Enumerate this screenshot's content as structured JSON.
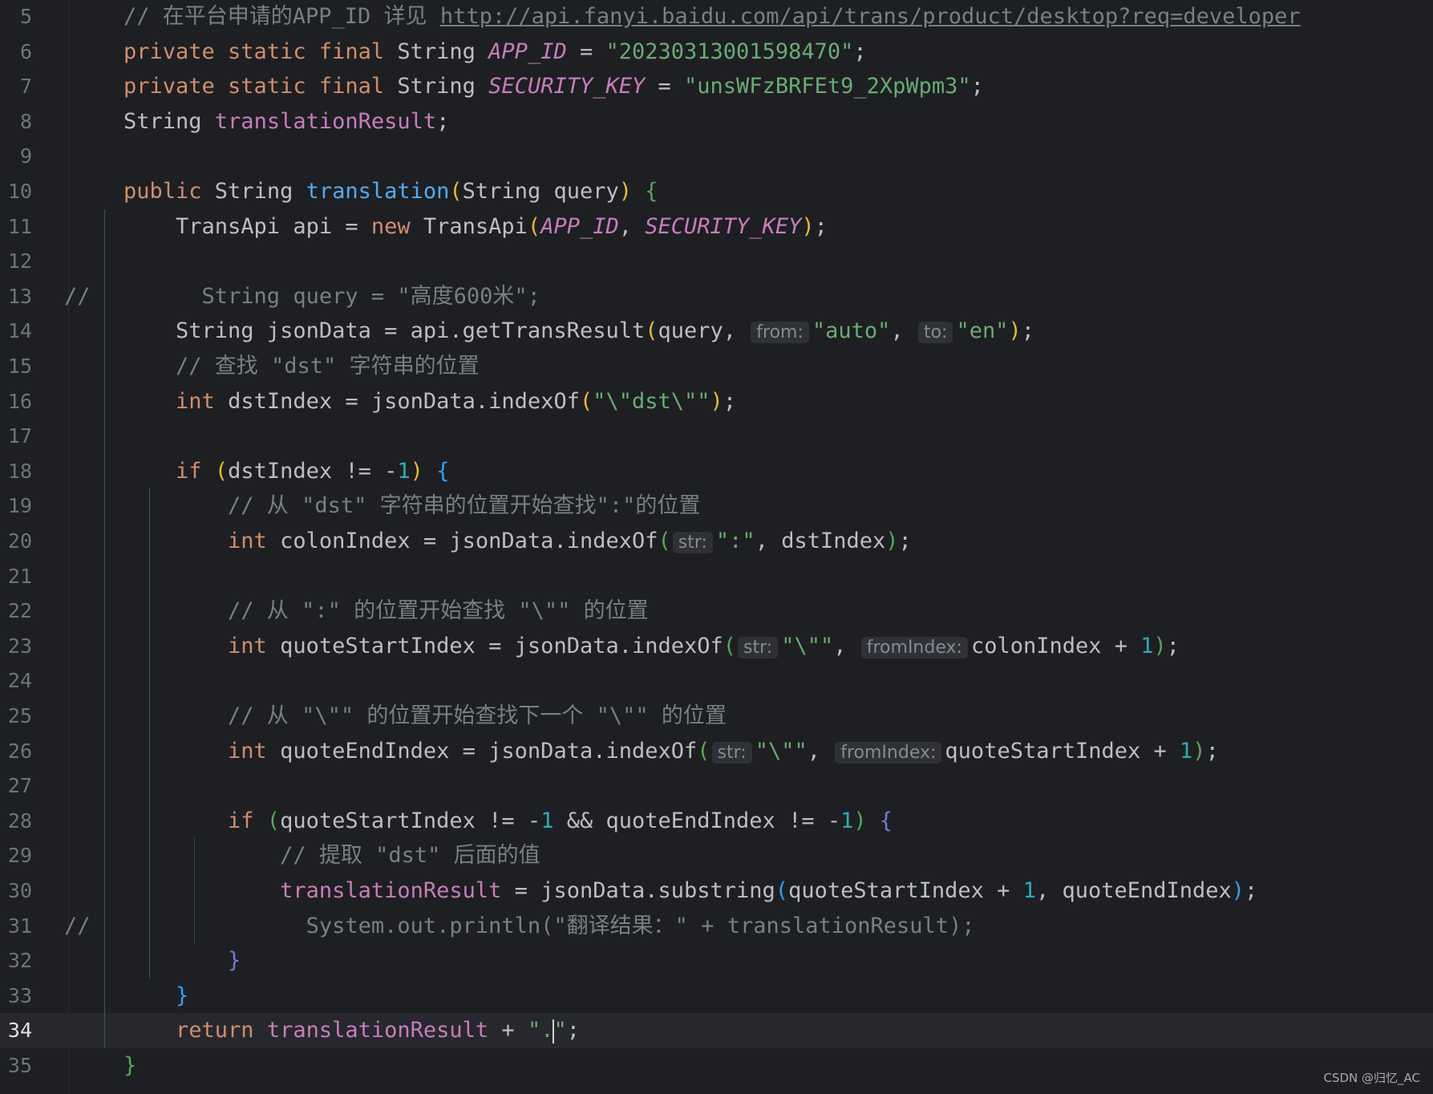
{
  "editor": {
    "current_line": 34,
    "watermark": "CSDN @归忆_AC",
    "lines": [
      {
        "n": "5",
        "tokens": [
          {
            "t": "// 在平台申请的APP_ID 详见 ",
            "c": "cmt"
          },
          {
            "t": "http://api.fanyi.baidu.com/api/trans/product/desktop?req=developer",
            "c": "url"
          }
        ]
      },
      {
        "n": "6",
        "tokens": [
          {
            "t": "private static final ",
            "c": "kw"
          },
          {
            "t": "String "
          },
          {
            "t": "APP_ID",
            "c": "sfld"
          },
          {
            "t": " = "
          },
          {
            "t": "\"20230313001598470\"",
            "c": "str"
          },
          {
            "t": ";"
          }
        ]
      },
      {
        "n": "7",
        "tokens": [
          {
            "t": "private static final ",
            "c": "kw"
          },
          {
            "t": "String "
          },
          {
            "t": "SECURITY_KEY",
            "c": "sfld"
          },
          {
            "t": " = "
          },
          {
            "t": "\"unsWFzBRFEt9_2XpWpm3\"",
            "c": "str"
          },
          {
            "t": ";"
          }
        ]
      },
      {
        "n": "8",
        "tokens": [
          {
            "t": "String "
          },
          {
            "t": "translationResult",
            "c": "fld"
          },
          {
            "t": ";"
          }
        ]
      },
      {
        "n": "9",
        "tokens": []
      },
      {
        "n": "10",
        "tokens": [
          {
            "t": "public ",
            "c": "kw"
          },
          {
            "t": "String "
          },
          {
            "t": "translation",
            "c": "fn"
          },
          {
            "t": "(",
            "c": "p1"
          },
          {
            "t": "String query"
          },
          {
            "t": ")",
            "c": "p1"
          },
          {
            "t": " "
          },
          {
            "t": "{",
            "c": "p2"
          }
        ]
      },
      {
        "n": "11",
        "tokens": [
          {
            "t": "    TransApi api = "
          },
          {
            "t": "new ",
            "c": "kw"
          },
          {
            "t": "TransApi"
          },
          {
            "t": "(",
            "c": "p1"
          },
          {
            "t": "APP_ID",
            "c": "sfld"
          },
          {
            "t": ", "
          },
          {
            "t": "SECURITY_KEY",
            "c": "sfld"
          },
          {
            "t": ")",
            "c": "p1"
          },
          {
            "t": ";"
          }
        ]
      },
      {
        "n": "12",
        "tokens": []
      },
      {
        "n": "13",
        "prefix": "//",
        "tokens": [
          {
            "t": "      String query = \"高度600米\";",
            "c": "cmt"
          }
        ]
      },
      {
        "n": "14",
        "tokens": [
          {
            "t": "    String jsonData = api.getTransResult"
          },
          {
            "t": "(",
            "c": "p1"
          },
          {
            "t": "query, "
          },
          {
            "t": "from:",
            "h": true
          },
          {
            "t": "\"auto\"",
            "c": "str"
          },
          {
            "t": ", "
          },
          {
            "t": "to:",
            "h": true
          },
          {
            "t": "\"en\"",
            "c": "str"
          },
          {
            "t": ")",
            "c": "p1"
          },
          {
            "t": ";"
          }
        ]
      },
      {
        "n": "15",
        "tokens": [
          {
            "t": "    // 查找 \"dst\" 字符串的位置",
            "c": "cmt"
          }
        ]
      },
      {
        "n": "16",
        "tokens": [
          {
            "t": "    "
          },
          {
            "t": "int ",
            "c": "kw"
          },
          {
            "t": "dstIndex = jsonData.indexOf"
          },
          {
            "t": "(",
            "c": "p1"
          },
          {
            "t": "\"\\\"dst\\\"\"",
            "c": "str"
          },
          {
            "t": ")",
            "c": "p1"
          },
          {
            "t": ";"
          }
        ]
      },
      {
        "n": "17",
        "tokens": []
      },
      {
        "n": "18",
        "tokens": [
          {
            "t": "    "
          },
          {
            "t": "if ",
            "c": "kw"
          },
          {
            "t": "(",
            "c": "p1"
          },
          {
            "t": "dstIndex != -"
          },
          {
            "t": "1",
            "c": "num"
          },
          {
            "t": ")",
            "c": "p1"
          },
          {
            "t": " "
          },
          {
            "t": "{",
            "c": "p3"
          }
        ]
      },
      {
        "n": "19",
        "tokens": [
          {
            "t": "        // 从 \"dst\" 字符串的位置开始查找\":\"的位置",
            "c": "cmt"
          }
        ]
      },
      {
        "n": "20",
        "tokens": [
          {
            "t": "        "
          },
          {
            "t": "int ",
            "c": "kw"
          },
          {
            "t": "colonIndex = jsonData.indexOf"
          },
          {
            "t": "(",
            "c": "p2"
          },
          {
            "t": "str:",
            "h": true
          },
          {
            "t": "\":\"",
            "c": "str"
          },
          {
            "t": ", dstIndex"
          },
          {
            "t": ")",
            "c": "p2"
          },
          {
            "t": ";"
          }
        ]
      },
      {
        "n": "21",
        "tokens": []
      },
      {
        "n": "22",
        "tokens": [
          {
            "t": "        // 从 \":\" 的位置开始查找 \"\\\"\" 的位置",
            "c": "cmt"
          }
        ]
      },
      {
        "n": "23",
        "tokens": [
          {
            "t": "        "
          },
          {
            "t": "int ",
            "c": "kw"
          },
          {
            "t": "quoteStartIndex = jsonData.indexOf"
          },
          {
            "t": "(",
            "c": "p2"
          },
          {
            "t": "str:",
            "h": true
          },
          {
            "t": "\"\\\"\"",
            "c": "str"
          },
          {
            "t": ", "
          },
          {
            "t": "fromIndex:",
            "h": true
          },
          {
            "t": "colonIndex + "
          },
          {
            "t": "1",
            "c": "num"
          },
          {
            "t": ")",
            "c": "p2"
          },
          {
            "t": ";"
          }
        ]
      },
      {
        "n": "24",
        "tokens": []
      },
      {
        "n": "25",
        "tokens": [
          {
            "t": "        // 从 \"\\\"\" 的位置开始查找下一个 \"\\\"\" 的位置",
            "c": "cmt"
          }
        ]
      },
      {
        "n": "26",
        "tokens": [
          {
            "t": "        "
          },
          {
            "t": "int ",
            "c": "kw"
          },
          {
            "t": "quoteEndIndex = jsonData.indexOf"
          },
          {
            "t": "(",
            "c": "p2"
          },
          {
            "t": "str:",
            "h": true
          },
          {
            "t": "\"\\\"\"",
            "c": "str"
          },
          {
            "t": ", "
          },
          {
            "t": "fromIndex:",
            "h": true
          },
          {
            "t": "quoteStartIndex + "
          },
          {
            "t": "1",
            "c": "num"
          },
          {
            "t": ")",
            "c": "p2"
          },
          {
            "t": ";"
          }
        ]
      },
      {
        "n": "27",
        "tokens": []
      },
      {
        "n": "28",
        "tokens": [
          {
            "t": "        "
          },
          {
            "t": "if ",
            "c": "kw"
          },
          {
            "t": "(",
            "c": "p2"
          },
          {
            "t": "quoteStartIndex != -"
          },
          {
            "t": "1",
            "c": "num"
          },
          {
            "t": " && quoteEndIndex != -"
          },
          {
            "t": "1",
            "c": "num"
          },
          {
            "t": ")",
            "c": "p2"
          },
          {
            "t": " "
          },
          {
            "t": "{",
            "c": "p4"
          }
        ]
      },
      {
        "n": "29",
        "tokens": [
          {
            "t": "            // 提取 \"dst\" 后面的值",
            "c": "cmt"
          }
        ]
      },
      {
        "n": "30",
        "tokens": [
          {
            "t": "            "
          },
          {
            "t": "translationResult",
            "c": "fld"
          },
          {
            "t": " = jsonData.substring"
          },
          {
            "t": "(",
            "c": "p3"
          },
          {
            "t": "quoteStartIndex + "
          },
          {
            "t": "1",
            "c": "num"
          },
          {
            "t": ", quoteEndIndex"
          },
          {
            "t": ")",
            "c": "p3"
          },
          {
            "t": ";"
          }
        ]
      },
      {
        "n": "31",
        "prefix": "//",
        "tokens": [
          {
            "t": "              System.out.println(\"翻译结果：\" + translationResult);",
            "c": "cmt"
          }
        ]
      },
      {
        "n": "32",
        "tokens": [
          {
            "t": "        "
          },
          {
            "t": "}",
            "c": "p4"
          }
        ]
      },
      {
        "n": "33",
        "tokens": [
          {
            "t": "    "
          },
          {
            "t": "}",
            "c": "p3"
          }
        ]
      },
      {
        "n": "34",
        "tokens": [
          {
            "t": "    "
          },
          {
            "t": "return ",
            "c": "kw"
          },
          {
            "t": "translationResult",
            "c": "fld"
          },
          {
            "t": " + "
          },
          {
            "t": "\".",
            "c": "str"
          },
          {
            "caret": true
          },
          {
            "t": "\"",
            "c": "str"
          },
          {
            "t": ";"
          }
        ]
      },
      {
        "n": "35",
        "tokens": [
          {
            "t": "}",
            "c": "p2"
          }
        ]
      }
    ]
  }
}
